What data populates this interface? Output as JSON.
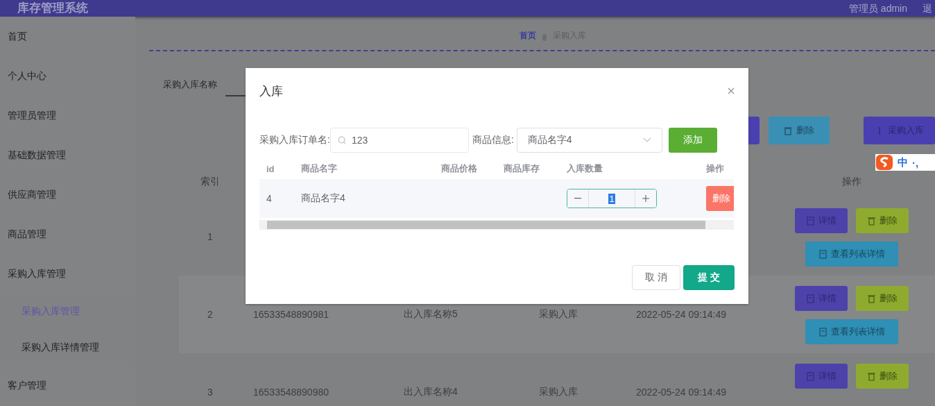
{
  "header": {
    "title": "库存管理系统",
    "user": "管理员 admin",
    "logout": "退"
  },
  "sidebar": {
    "items": [
      {
        "label": "首页",
        "selected": false
      },
      {
        "label": "个人中心",
        "selected": false
      },
      {
        "label": "管理员管理",
        "selected": false
      },
      {
        "label": "基础数据管理",
        "selected": false
      },
      {
        "label": "供应商管理",
        "selected": false
      },
      {
        "label": "商品管理",
        "selected": false
      },
      {
        "label": "采购入库管理",
        "selected": false,
        "expanded": true,
        "children": [
          {
            "label": "采购入库管理",
            "selected": true
          },
          {
            "label": "采购入库详情管理",
            "selected": false
          }
        ]
      },
      {
        "label": "客户管理",
        "selected": false
      }
    ]
  },
  "breadcrumb": [
    "首页",
    "采购入库"
  ],
  "search": {
    "label": "采购入库名称"
  },
  "toolbar": {
    "buttons": [
      {
        "kind": "add"
      },
      {
        "kind": "delete",
        "label": "删除"
      },
      {
        "kind": "purchase",
        "label": "采购入库"
      }
    ]
  },
  "table": {
    "columns": [
      "索引",
      "操作"
    ],
    "rows": [
      {
        "index": "1",
        "actions": [
          {
            "kind": "detail",
            "label": "详情"
          },
          {
            "kind": "delete",
            "label": "删除"
          },
          {
            "kind": "list",
            "label": "查看列表详情"
          }
        ]
      },
      {
        "index": "2",
        "order_no": "16533548890981",
        "name": "出入库名称5",
        "type": "采购入库",
        "time": "2022-05-24 09:14:49",
        "actions": [
          {
            "kind": "detail",
            "label": "详情"
          },
          {
            "kind": "delete",
            "label": "删除"
          },
          {
            "kind": "list",
            "label": "查看列表详情"
          }
        ]
      },
      {
        "index": "3",
        "order_no": "16533548890980",
        "name": "出入库名称4",
        "type": "采购入库",
        "time": "2022-05-24 09:14:49",
        "actions": [
          {
            "kind": "detail",
            "label": "详情"
          },
          {
            "kind": "delete",
            "label": "删除"
          }
        ]
      }
    ]
  },
  "dialog": {
    "title": "入库",
    "form": {
      "order_label": "采购入库订单名:",
      "order_value": "123",
      "goods_label": "商品信息:",
      "goods_value": "商品名字4",
      "add": "添加"
    },
    "items_table": {
      "columns": [
        "id",
        "商品名字",
        "商品价格",
        "商品库存",
        "入库数量",
        "操作"
      ],
      "rows": [
        {
          "id": "4",
          "name": "商品名字4",
          "quantity": "1",
          "action": "删除"
        }
      ]
    },
    "buttons": [
      {
        "kind": "cancel",
        "label": "取 消"
      },
      {
        "kind": "submit",
        "label": "提 交"
      }
    ]
  },
  "ime": {
    "mode": "中",
    "punct": "·,"
  }
}
